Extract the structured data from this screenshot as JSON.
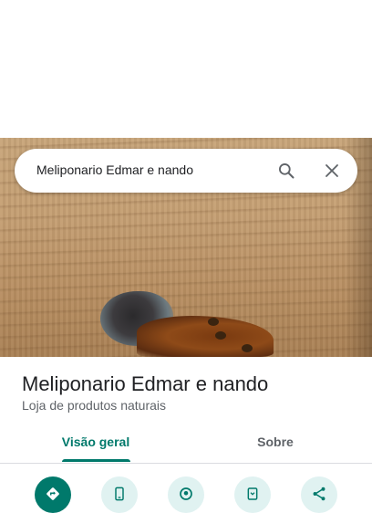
{
  "search": {
    "query": "Meliponario Edmar e nando",
    "search_icon": "search-icon",
    "close_icon": "close-icon"
  },
  "place": {
    "name": "Meliponario Edmar e nando",
    "category": "Loja de produtos naturais"
  },
  "tabs": [
    {
      "label": "Visão geral",
      "selected": true
    },
    {
      "label": "Sobre",
      "selected": false
    }
  ],
  "actions": [
    {
      "icon": "directions-icon"
    },
    {
      "icon": "phone-icon"
    },
    {
      "icon": "nearby-icon"
    },
    {
      "icon": "save-icon"
    },
    {
      "icon": "share-icon"
    }
  ],
  "colors": {
    "accent": "#00796b",
    "action_bg": "#e0f2f1",
    "text_primary": "#202124",
    "text_secondary": "#5f6368"
  }
}
